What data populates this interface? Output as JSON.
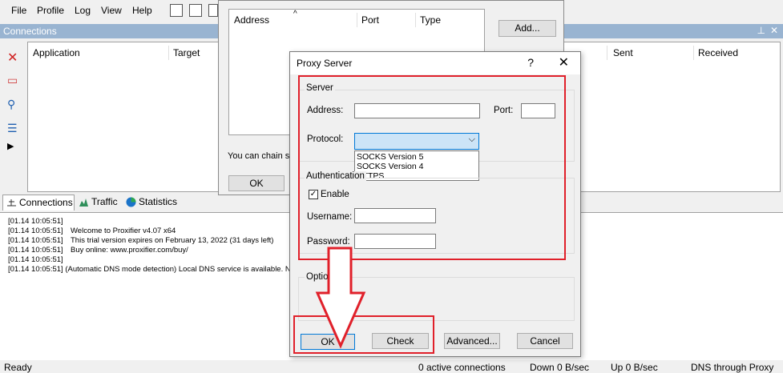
{
  "menu": [
    "File",
    "Profile",
    "Log",
    "View",
    "Help"
  ],
  "connections": {
    "title": "Connections",
    "columns": [
      "Application",
      "Target",
      "Sent",
      "Received"
    ]
  },
  "tabs": [
    "Connections",
    "Traffic",
    "Statistics"
  ],
  "log": [
    {
      "ts": "[01.14 10:05:51]",
      "msg": ""
    },
    {
      "ts": "[01.14 10:05:51]",
      "msg": "Welcome to Proxifier v4.07 x64"
    },
    {
      "ts": "[01.14 10:05:51]",
      "msg": "This trial version expires on February 13, 2022 (31 days left)"
    },
    {
      "ts": "[01.14 10:05:51]",
      "msg": "Buy online: www.proxifier.com/buy/"
    },
    {
      "ts": "[01.14 10:05:51]",
      "msg": ""
    },
    {
      "ts": "[01.14 10:05:51]",
      "msg": "(Automatic DNS mode detection) Local DNS service is available. Nar"
    }
  ],
  "status": {
    "ready": "Ready",
    "active": "0 active connections",
    "down": "Down 0 B/sec",
    "up": "Up 0 B/sec",
    "dns": "DNS through Proxy"
  },
  "back_dialog": {
    "columns": [
      "Address",
      "Port",
      "Type"
    ],
    "add_button": "Add...",
    "chain_text": "You can chain se",
    "ok_button": "OK"
  },
  "proxy_dialog": {
    "title": "Proxy Server",
    "help": "?",
    "close": "✕",
    "server_group": "Server",
    "address_label": "Address:",
    "port_label": "Port:",
    "protocol_label": "Protocol:",
    "protocol_options": [
      "SOCKS Version 5",
      "SOCKS Version 4",
      "HTTPS"
    ],
    "auth_group": "Authentication",
    "enable_label": "Enable",
    "username_label": "Username:",
    "password_label": "Password:",
    "options_group": "Optio",
    "buttons": {
      "ok": "OK",
      "check": "Check",
      "advanced": "Advanced...",
      "cancel": "Cancel"
    }
  },
  "colors": {
    "highlight": "#e0202a",
    "title_bar": "#99b4d1",
    "accent": "#0078d7"
  }
}
